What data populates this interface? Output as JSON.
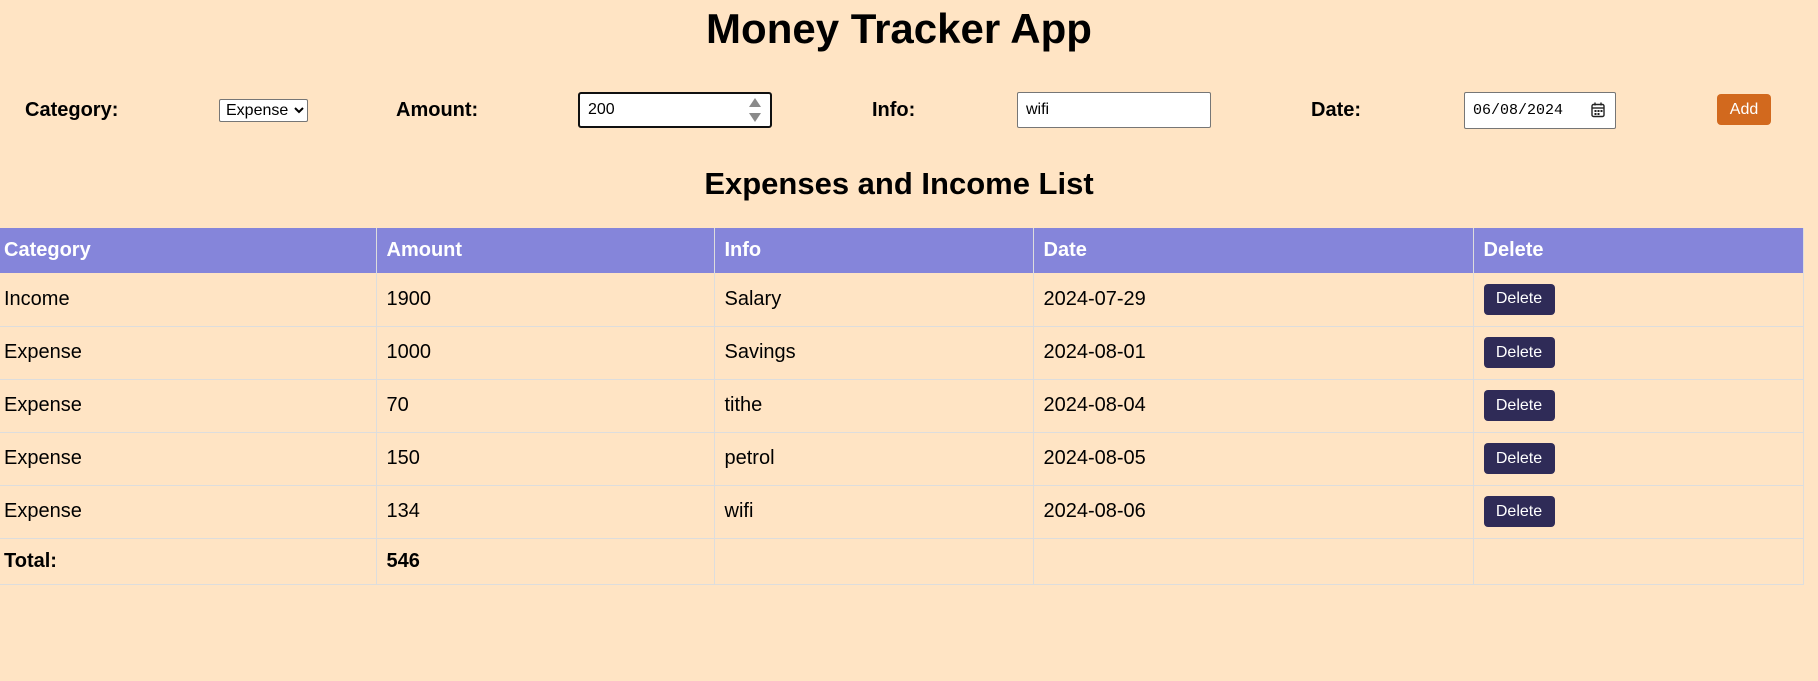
{
  "app": {
    "title": "Money Tracker App"
  },
  "form": {
    "category_label": "Category:",
    "category_value": "Expense",
    "amount_label": "Amount:",
    "amount_value": "200",
    "info_label": "Info:",
    "info_value": "wifi",
    "date_label": "Date:",
    "date_value": "06/08/2024",
    "add_label": "Add"
  },
  "list": {
    "title": "Expenses and Income List",
    "columns": [
      "Category",
      "Amount",
      "Info",
      "Date",
      "Delete"
    ],
    "rows": [
      {
        "category": "Income",
        "amount": "1900",
        "info": "Salary",
        "date": "2024-07-29",
        "delete_label": "Delete"
      },
      {
        "category": "Expense",
        "amount": "1000",
        "info": "Savings",
        "date": "2024-08-01",
        "delete_label": "Delete"
      },
      {
        "category": "Expense",
        "amount": "70",
        "info": "tithe",
        "date": "2024-08-04",
        "delete_label": "Delete"
      },
      {
        "category": "Expense",
        "amount": "150",
        "info": "petrol",
        "date": "2024-08-05",
        "delete_label": "Delete"
      },
      {
        "category": "Expense",
        "amount": "134",
        "info": "wifi",
        "date": "2024-08-06",
        "delete_label": "Delete"
      }
    ],
    "total_label": "Total:",
    "total_value": "546"
  },
  "colors": {
    "background": "#ffe4c4",
    "header": "#8585da",
    "add_button": "#d2691e",
    "delete_button": "#2f2b57"
  },
  "icons": {
    "date_picker": "calendar-icon",
    "amount_stepper": "spinner-arrows-icon",
    "select_arrow": "chevron-down-icon"
  }
}
